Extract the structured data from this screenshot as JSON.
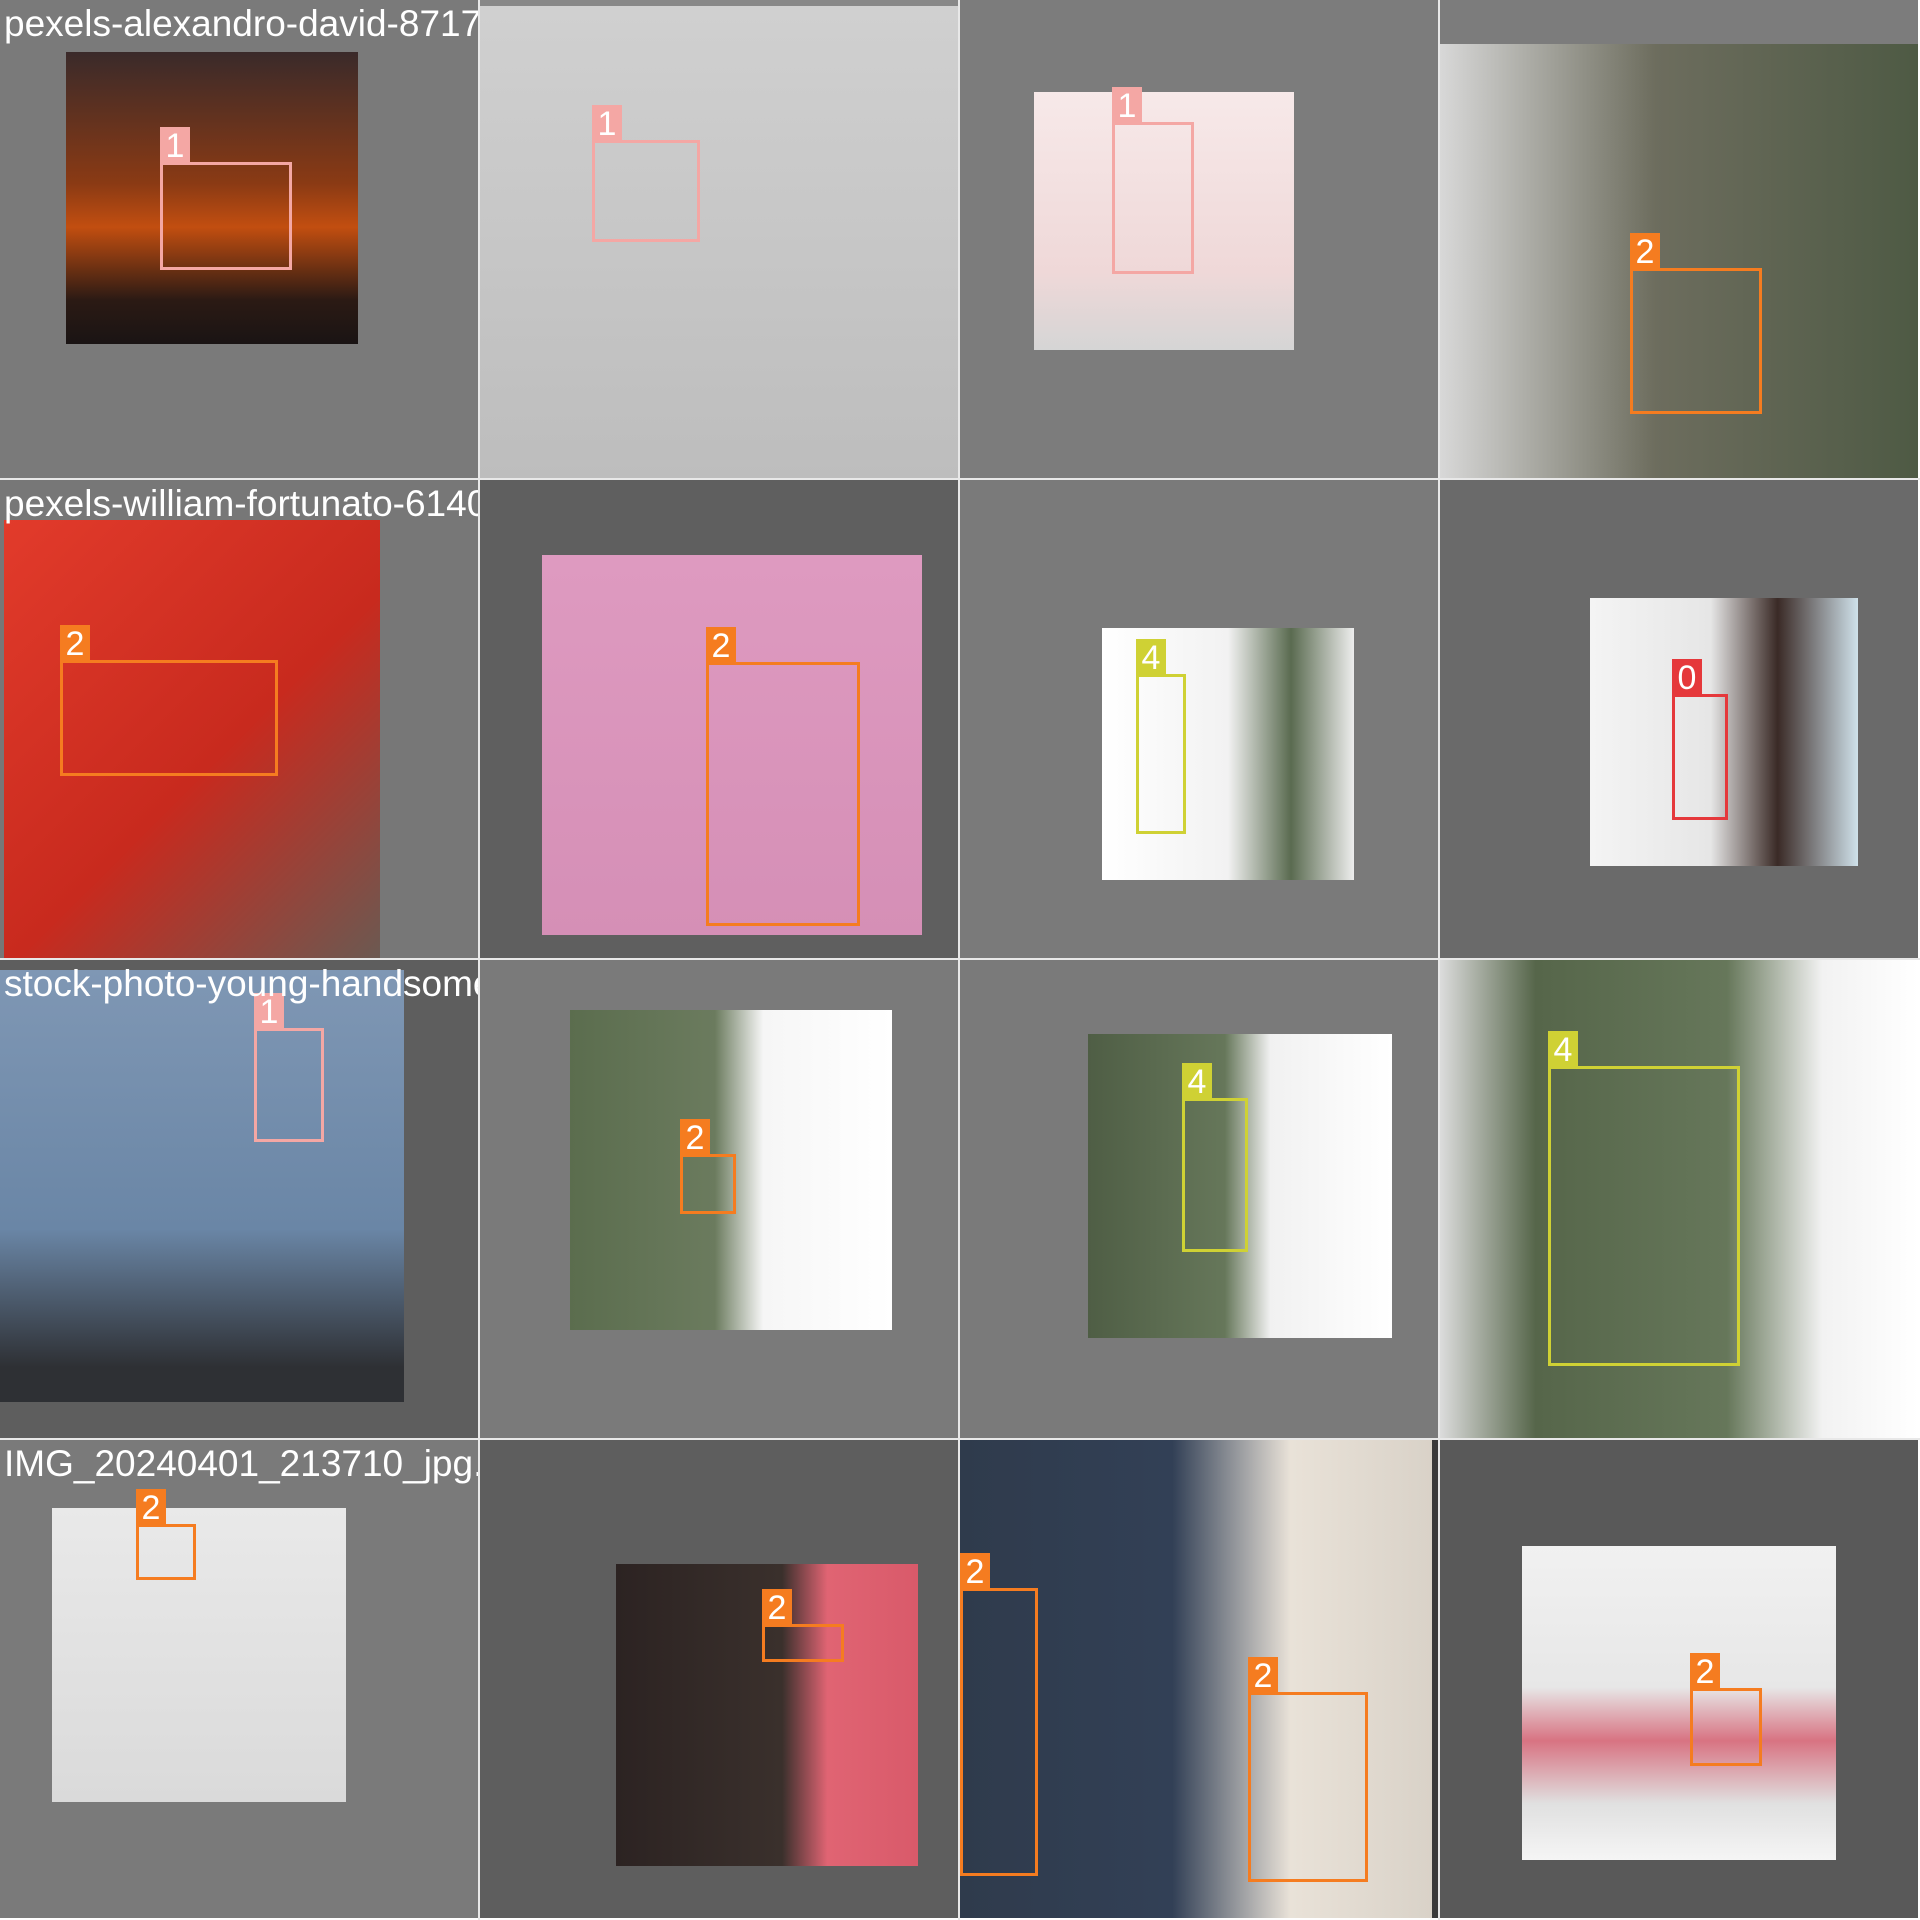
{
  "tiles": [
    {
      "name": "tile-sunset-ok-sign",
      "filename": "pexels-alexandro-david-8717133-3692204_jpg_213722_jpg.rf.f702d1623569-3810017_jpg.rf.2024040_213651_1_",
      "bg": "#7a7a7a",
      "photo_bg": "linear-gradient(180deg,#3a2a2a 0%,#8a3a14 45%,#c24e10 60%,#2b1a14 85%,#1a1414 100%)",
      "boxes": [
        {
          "cls": "1"
        }
      ]
    },
    {
      "name": "tile-man-ok-sign-wall",
      "filename": "",
      "bg": "#888888",
      "photo_bg": "linear-gradient(180deg,#d0d0d0 0%,#bdbdbd 100%)",
      "boxes": [
        {
          "cls": "1"
        }
      ]
    },
    {
      "name": "tile-ok-sign-bracelet",
      "filename": "",
      "bg": "#7c7c7c",
      "photo_bg": "linear-gradient(180deg,#f7e9e9 0%,#efd8d8 70%,#d5d5d5 100%)",
      "boxes": [
        {
          "cls": "1"
        }
      ]
    },
    {
      "name": "tile-man-rotated-closeup",
      "filename": "",
      "bg": "#7c7c7c",
      "photo_bg": "linear-gradient(90deg,#d8d8d8 0%,#6d6d5e 45%,#4e5a44 100%)",
      "boxes": [
        {
          "cls": "2"
        }
      ]
    },
    {
      "name": "tile-red-shirt-thumb",
      "filename": "pexels-william-fortunato-6140706_jpg.rf.jpg.rf.f9362d4cab3MG_20240401_213644_jpg.rf.e6ea32_edb5d7c99a8b67",
      "bg": "#777777",
      "photo_bg": "linear-gradient(135deg,#e23b2b 0%,#c82a1e 55%,#6a5a52 100%)",
      "boxes": [
        {
          "cls": "2"
        }
      ]
    },
    {
      "name": "tile-pink-thumb-down",
      "filename": "",
      "bg": "#5f5f5f",
      "photo_bg": "linear-gradient(180deg,#de9ac0 0%,#d58fb6 100%)",
      "boxes": [
        {
          "cls": "2"
        }
      ]
    },
    {
      "name": "tile-man-two-hands-rotated",
      "filename": "",
      "bg": "#7a7a7a",
      "photo_bg": "linear-gradient(90deg,#ffffff 0%,#f2f2f2 50%,#5a6b50 75%,#ededed 100%)",
      "boxes": [
        {
          "cls": "4"
        }
      ]
    },
    {
      "name": "tile-woman-thumb-down",
      "filename": "",
      "bg": "#6a6a6a",
      "photo_bg": "linear-gradient(90deg,#f4f4f4 0%,#e6e6e6 45%,#3a2a26 70%,#cfe1ea 100%)",
      "boxes": [
        {
          "cls": "0"
        }
      ]
    },
    {
      "name": "tile-smiling-man-ok",
      "filename": "stock-photo-young-handsome-man-with-beard_213702_jpg.rf.4b2ac4708d3_213634_jpg.rf.IMG_20240401_213634",
      "bg": "#5e5e5e",
      "photo_bg": "linear-gradient(180deg,#7f97b4 0%,#6a86a6 60%,#2e3034 92%,#2e3034 100%)",
      "boxes": [
        {
          "cls": "1"
        }
      ]
    },
    {
      "name": "tile-man-rotated-thumb",
      "filename": "",
      "bg": "#7a7a7a",
      "photo_bg": "linear-gradient(90deg,#5b6d4e 0%,#6b7b5e 45%,#f6f6f6 60%,#ffffff 100%)",
      "boxes": [
        {
          "cls": "2"
        }
      ]
    },
    {
      "name": "tile-man-rotated-both-thumbs",
      "filename": "",
      "bg": "#7a7a7a",
      "photo_bg": "linear-gradient(90deg,#4f5e45 0%,#66775a 45%,#f1f1f1 60%,#ffffff 100%)",
      "boxes": [
        {
          "cls": "4"
        }
      ]
    },
    {
      "name": "tile-man-rotated-large",
      "filename": "",
      "bg": "#7a7a7a",
      "photo_bg": "linear-gradient(90deg,#dcdcdc 0%,#56664a 20%,#66775a 60%,#f2f2f2 80%,#ffffff 100%)",
      "boxes": [
        {
          "cls": "4"
        }
      ]
    },
    {
      "name": "tile-man-thumb-overhead",
      "filename": "IMG_20240401_213710_jpg.rf.b42fa15a7868623_jpg.rf.ead5d3c3afb7-7564596_jpg.rf.e14ladfe21-8439756_jpg",
      "bg": "#7a7a7a",
      "photo_bg": "linear-gradient(180deg,#e9e9e9 0%,#dadada 100%)",
      "boxes": [
        {
          "cls": "2"
        }
      ]
    },
    {
      "name": "tile-pink-suit-man",
      "filename": "",
      "bg": "#5e5e5e",
      "photo_bg": "linear-gradient(90deg,#2c2322 0%,#3a302c 55%,#e06473 70%,#d95a6a 100%)",
      "boxes": [
        {
          "cls": "2"
        }
      ]
    },
    {
      "name": "tile-two-men-thumbs",
      "filename": "",
      "bg": "#3a3a3a",
      "photo_bg": "linear-gradient(90deg,#2f3b4c 0%,#324056 45%,#e9e2d8 70%,#d9d2c8 100%)",
      "boxes": [
        {
          "cls": "2"
        },
        {
          "cls": "2"
        }
      ]
    },
    {
      "name": "tile-woman-thumb-desk",
      "filename": "",
      "bg": "#595959",
      "photo_bg": "linear-gradient(180deg,#f1f1f1 0%,#e7e7e7 45%,#d87382 62%,#e0e0e0 82%,#f5f5f5 100%)",
      "boxes": [
        {
          "cls": "2"
        }
      ]
    }
  ]
}
